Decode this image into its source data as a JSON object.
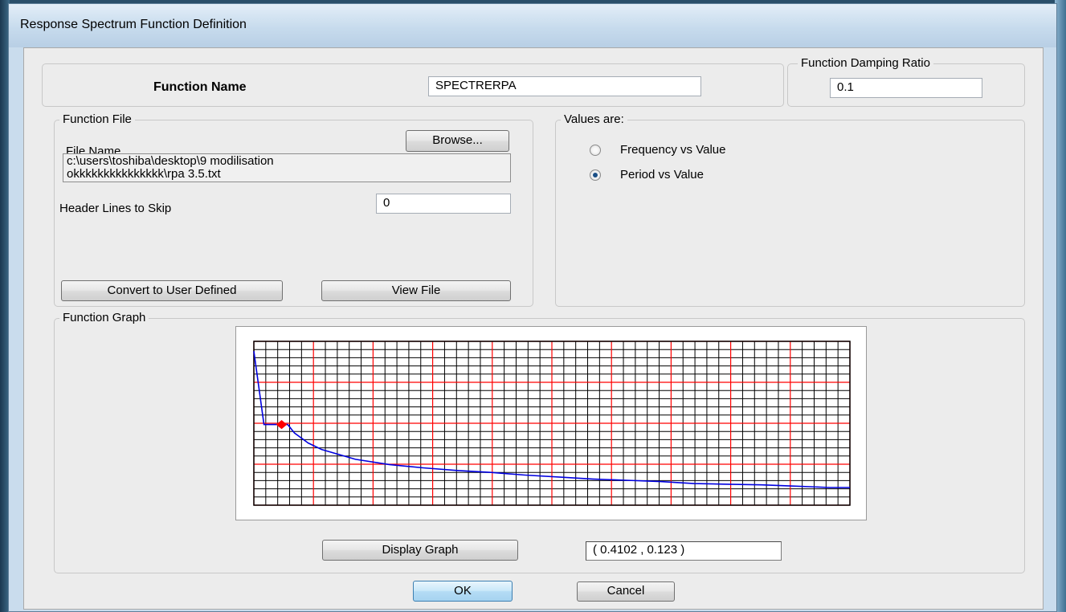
{
  "window": {
    "title": "Response Spectrum  Function Definition"
  },
  "function_name": {
    "label": "Function Name",
    "value": "SPECTRERPA"
  },
  "damping": {
    "label": "Function Damping Ratio",
    "value": "0.1"
  },
  "function_file": {
    "group_label": "Function File",
    "file_name_label": "File Name",
    "browse_label": "Browse...",
    "path_line1": "c:\\users\\toshiba\\desktop\\9 modilisation",
    "path_line2": "okkkkkkkkkkkkkkk\\rpa 3.5.txt",
    "header_lines_label": "Header Lines to Skip",
    "header_lines_value": "0",
    "convert_label": "Convert to User Defined",
    "view_file_label": "View File"
  },
  "values_are": {
    "group_label": "Values are:",
    "options": [
      {
        "label": "Frequency vs Value",
        "checked": false
      },
      {
        "label": "Period vs Value",
        "checked": true
      }
    ]
  },
  "function_graph": {
    "group_label": "Function Graph",
    "display_label": "Display Graph",
    "coord_readout": "( 0.4102  ,  0.123 )"
  },
  "buttons": {
    "ok": "OK",
    "cancel": "Cancel"
  },
  "colors": {
    "curve": "#0000e0",
    "major_grid": "#ff0000",
    "minor_grid": "#000000",
    "marker": "#ff0000"
  },
  "chart_data": {
    "type": "line",
    "series": [
      {
        "values": [
          [
            0.0,
            0.235
          ],
          [
            0.15,
            0.123
          ],
          [
            0.5,
            0.123
          ],
          [
            0.6,
            0.11
          ],
          [
            0.8,
            0.095
          ],
          [
            1.0,
            0.085
          ],
          [
            1.5,
            0.07
          ],
          [
            2.0,
            0.062
          ],
          [
            2.5,
            0.057
          ],
          [
            3.0,
            0.053
          ],
          [
            3.5,
            0.05
          ],
          [
            4.0,
            0.046
          ],
          [
            4.5,
            0.043
          ],
          [
            5.0,
            0.04
          ],
          [
            5.5,
            0.038
          ],
          [
            6.0,
            0.036
          ],
          [
            6.5,
            0.033
          ],
          [
            7.0,
            0.032
          ],
          [
            7.5,
            0.031
          ],
          [
            8.0,
            0.029
          ],
          [
            8.5,
            0.027
          ],
          [
            8.8,
            0.027
          ]
        ]
      }
    ],
    "marker": {
      "x": 0.41,
      "y": 0.123
    },
    "xlim": [
      0,
      8.8
    ],
    "ylim": [
      0,
      0.25
    ],
    "grid": true
  }
}
